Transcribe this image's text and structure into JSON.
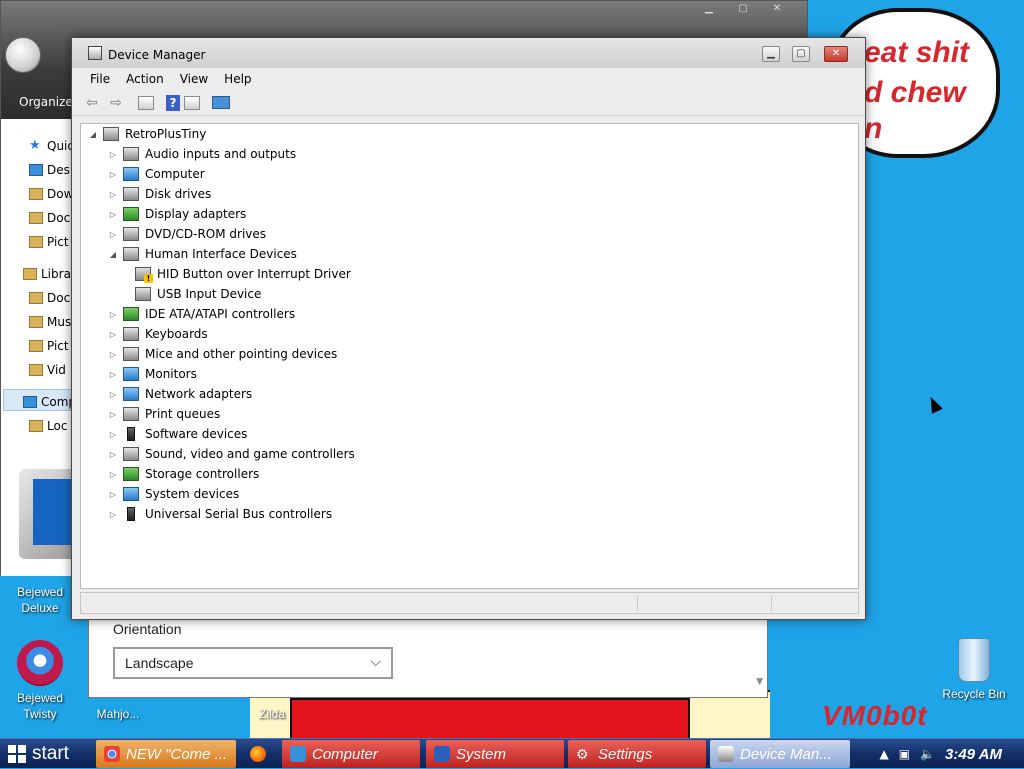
{
  "desktop": {
    "speech_lines": [
      "eat shit",
      "d chew",
      "n"
    ],
    "icons": {
      "bejewed_deluxe": "Bejewed\nDeluxe",
      "bejewed_twisty": "Bejewed Twisty",
      "recycle_bin": "Recycle Bin",
      "mahjo": "Mahjo...",
      "zilda": "Zilda"
    },
    "logo": "VM0b0t"
  },
  "explorer": {
    "organize": "Organize",
    "nav": [
      "Quic",
      "Des",
      "Dow",
      "Doc",
      "Pict",
      "Libra",
      "Doc",
      "Mus",
      "Pict",
      "Vid",
      "Comp",
      "Loc"
    ]
  },
  "settings": {
    "orientation_label": "Orientation",
    "orientation_value": "Landscape"
  },
  "device_manager": {
    "title": "Device Manager",
    "menu": [
      "File",
      "Action",
      "View",
      "Help"
    ],
    "root": "RetroPlusTiny",
    "categories": [
      "Audio inputs and outputs",
      "Computer",
      "Disk drives",
      "Display adapters",
      "DVD/CD-ROM drives",
      "Human Interface Devices",
      "IDE ATA/ATAPI controllers",
      "Keyboards",
      "Mice and other pointing devices",
      "Monitors",
      "Network adapters",
      "Print queues",
      "Software devices",
      "Sound, video and game controllers",
      "Storage controllers",
      "System devices",
      "Universal Serial Bus controllers"
    ],
    "hid_children": [
      "HID Button over Interrupt Driver",
      "USB Input Device"
    ]
  },
  "taskbar": {
    "start": "start",
    "tasks": [
      "NEW \"Come ...",
      "Computer",
      "System",
      "Settings",
      "Device Man..."
    ],
    "clock": "3:49 AM"
  }
}
